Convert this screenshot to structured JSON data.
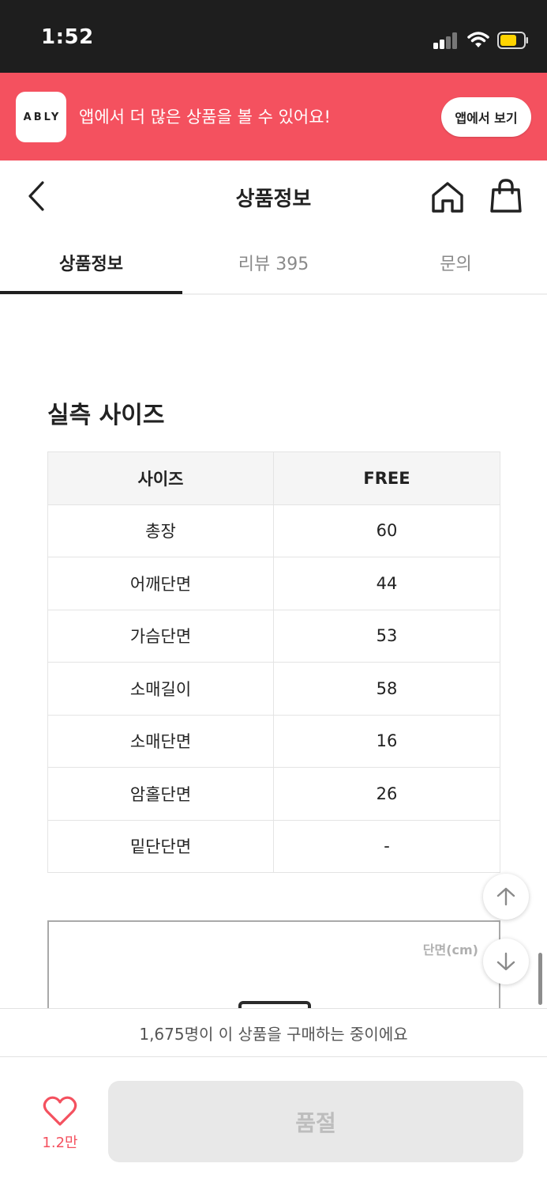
{
  "status_bar": {
    "time": "1:52"
  },
  "app_banner": {
    "logo_text": "ABLY",
    "message": "앱에서 더 많은 상품을 볼 수 있어요!",
    "button_label": "앱에서 보기",
    "background_color": "#f4515f"
  },
  "header": {
    "title": "상품정보",
    "icons": [
      "back-icon",
      "home-icon",
      "shopping-bag-icon"
    ]
  },
  "tabs": [
    {
      "label": "상품정보",
      "active": true
    },
    {
      "label": "리뷰 395",
      "active": false
    },
    {
      "label": "문의",
      "active": false
    }
  ],
  "size_section": {
    "title": "실측 사이즈",
    "header": {
      "label": "사이즈",
      "value": "FREE"
    },
    "rows": [
      {
        "label": "총장",
        "value": "60"
      },
      {
        "label": "어깨단면",
        "value": "44"
      },
      {
        "label": "가슴단면",
        "value": "53"
      },
      {
        "label": "소매길이",
        "value": "58"
      },
      {
        "label": "소매단면",
        "value": "16"
      },
      {
        "label": "암홀단면",
        "value": "26"
      },
      {
        "label": "밑단단면",
        "value": "-"
      }
    ]
  },
  "image_box": {
    "label": "단면(cm)"
  },
  "scroll_buttons": [
    "scroll-up-icon",
    "scroll-down-icon"
  ],
  "buyer_strip": {
    "text": "1,675명이 이 상품을 구매하는 중이에요"
  },
  "bottom_bar": {
    "like_count": "1.2만",
    "soldout_label": "품절",
    "accent_color": "#f4515f"
  }
}
